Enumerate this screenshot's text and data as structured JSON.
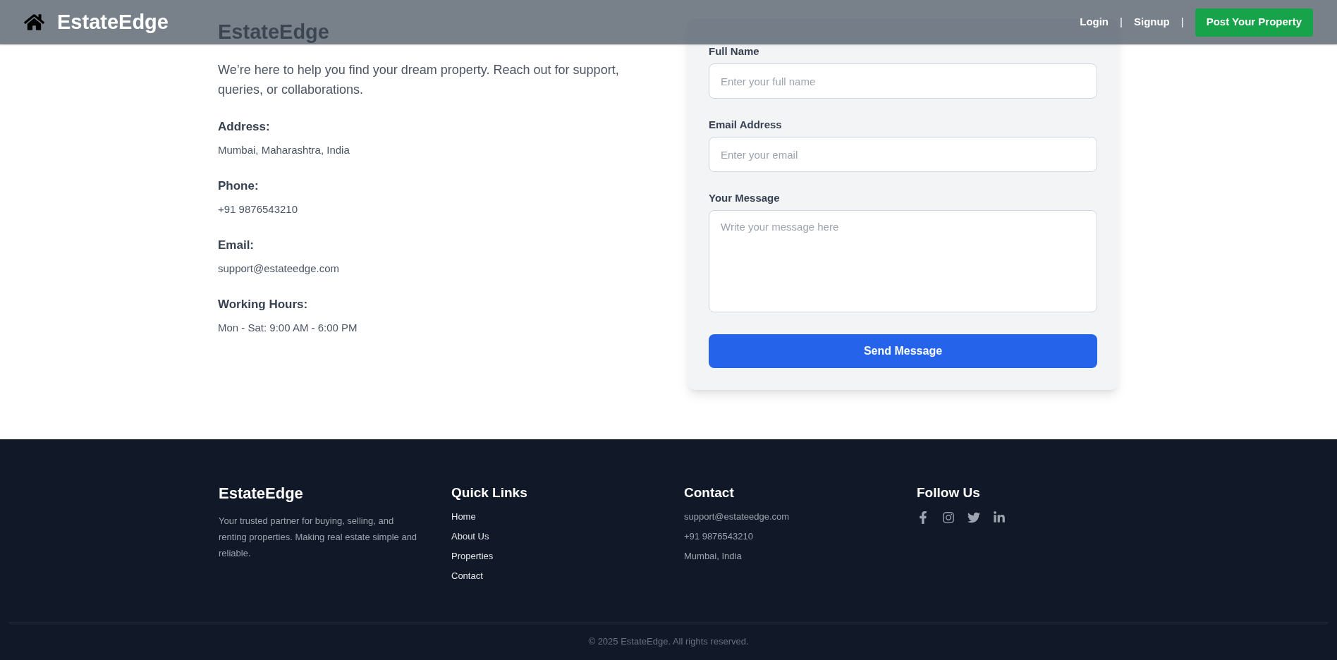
{
  "navbar": {
    "brand": "EstateEdge",
    "items": [
      {
        "kind": "link",
        "text": "Login"
      },
      {
        "kind": "separator",
        "text": "|"
      },
      {
        "kind": "link",
        "text": "Signup"
      },
      {
        "kind": "separator",
        "text": "|"
      }
    ],
    "cta": "Post Your Property"
  },
  "contact": {
    "heading": "EstateEdge",
    "intro": "We’re here to help you find your dream property. Reach out for support, queries, or collaborations.",
    "items": [
      {
        "label": "Address:",
        "value": "Mumbai, Maharashtra, India"
      },
      {
        "label": "Phone:",
        "value": "+91 9876543210"
      },
      {
        "label": "Email:",
        "value": "support@estateedge.com"
      },
      {
        "label": "Working Hours:",
        "value": "Mon - Sat: 9:00 AM - 6:00 PM"
      }
    ]
  },
  "form": {
    "fields": [
      {
        "kind": "input",
        "label": "Full Name",
        "placeholder": "Enter your full name"
      },
      {
        "kind": "input",
        "label": "Email Address",
        "placeholder": "Enter your email"
      },
      {
        "kind": "textarea",
        "label": "Your Message",
        "placeholder": "Write your message here"
      }
    ],
    "submit": "Send Message"
  },
  "footer": {
    "brand": {
      "name": "EstateEdge",
      "description": "Your trusted partner for buying, selling, and renting properties. Making real estate simple and reliable."
    },
    "quick_links": {
      "title": "Quick Links",
      "items": [
        "Home",
        "About Us",
        "Properties",
        "Contact"
      ]
    },
    "contact": {
      "title": "Contact",
      "items": [
        "support@estateedge.com",
        "+91 9876543210",
        "Mumbai, India"
      ]
    },
    "follow": {
      "title": "Follow Us"
    },
    "copyright": "© 2025 EstateEdge. All rights reserved."
  }
}
